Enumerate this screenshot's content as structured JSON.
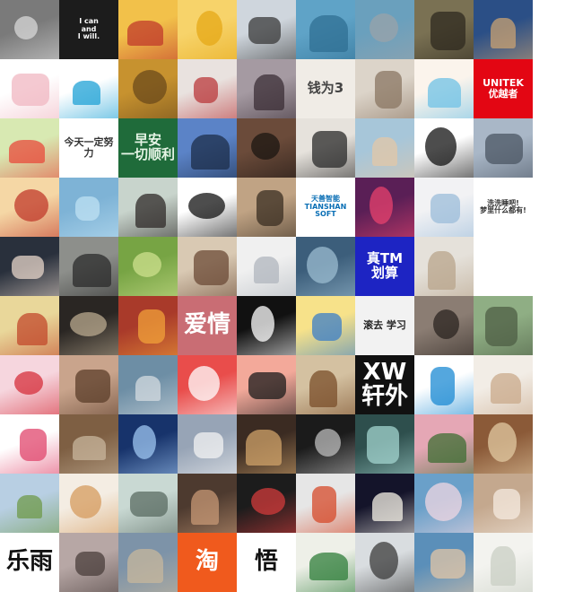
{
  "grid": {
    "columns": 9,
    "rows": 10,
    "tiles": [
      {
        "r": 0,
        "c": 0,
        "kind": "photo",
        "bg": "#7a7a7a",
        "fg": "#d8d8d8",
        "name": "child-street-photo"
      },
      {
        "r": 0,
        "c": 1,
        "kind": "text",
        "bg": "#1c1c1c",
        "fg": "#ffffff",
        "text": "I can\nand\nI will.",
        "name": "i-can-and-i-will-text"
      },
      {
        "r": 0,
        "c": 2,
        "kind": "photo",
        "bg": "#f2c14a",
        "fg": "#c0392b",
        "name": "one-piece-luffy-avatar"
      },
      {
        "r": 0,
        "c": 3,
        "kind": "photo",
        "bg": "#f7d36a",
        "fg": "#e6a817",
        "name": "emoji-face-avatar"
      },
      {
        "r": 0,
        "c": 4,
        "kind": "photo",
        "bg": "#cfd6dd",
        "fg": "#3a3a3a",
        "name": "headphones-boy-avatar"
      },
      {
        "r": 0,
        "c": 5,
        "kind": "photo",
        "bg": "#5fa3c7",
        "fg": "#2f6f93",
        "name": "boat-sea-photo"
      },
      {
        "r": 0,
        "c": 6,
        "kind": "photo",
        "bg": "#6aa0bd",
        "fg": "#9aa3aa",
        "name": "shark-photo"
      },
      {
        "r": 0,
        "c": 7,
        "kind": "photo",
        "bg": "#7a7153",
        "fg": "#2f2a1f",
        "name": "soldier-boy-photo"
      },
      {
        "r": 0,
        "c": 8,
        "kind": "photo",
        "bg": "#2b4f86",
        "fg": "#c9a172",
        "name": "coastal-town-photo"
      },
      {
        "r": 0,
        "c": 9,
        "kind": "photo",
        "bg": "#f3f3f3",
        "fg": "#c0392b",
        "name": "anime-red-hair-girl"
      },
      {
        "r": 1,
        "c": 0,
        "kind": "photo",
        "bg": "#ffffff",
        "fg": "#f0b7c2",
        "name": "cartoon-pig-avatar"
      },
      {
        "r": 1,
        "c": 1,
        "kind": "photo",
        "bg": "#ffffff",
        "fg": "#1fa2d6",
        "name": "music-note-logo"
      },
      {
        "r": 1,
        "c": 2,
        "kind": "photo",
        "bg": "#c7922f",
        "fg": "#6b4a1b",
        "name": "forest-trees-photo"
      },
      {
        "r": 1,
        "c": 3,
        "kind": "photo",
        "bg": "#e9e2df",
        "fg": "#b9383b",
        "name": "anime-girl-red-hat"
      },
      {
        "r": 1,
        "c": 4,
        "kind": "photo",
        "bg": "#a59aa2",
        "fg": "#3b2e36",
        "name": "dark-hair-girl-photo"
      },
      {
        "r": 1,
        "c": 5,
        "kind": "text",
        "bg": "#f0ece6",
        "fg": "#444444",
        "text": "钱为3",
        "name": "box-sketch-text"
      },
      {
        "r": 1,
        "c": 6,
        "kind": "photo",
        "bg": "#dcd4c9",
        "fg": "#8a7562",
        "name": "blonde-woman-photo"
      },
      {
        "r": 1,
        "c": 7,
        "kind": "photo",
        "bg": "#fbf4ec",
        "fg": "#6fc1e6",
        "name": "cinnamoroll-avatar"
      },
      {
        "r": 1,
        "c": 8,
        "kind": "text",
        "bg": "#e30613",
        "fg": "#ffffff",
        "text": "UNITEK\n优越者",
        "name": "unitek-logo"
      },
      {
        "r": 1,
        "c": 9,
        "kind": "empty",
        "bg": "#ffffff",
        "name": "empty-cell"
      },
      {
        "r": 2,
        "c": 0,
        "kind": "photo",
        "bg": "#d8e9b2",
        "fg": "#e84a3b",
        "name": "flowers-vase-photo"
      },
      {
        "r": 2,
        "c": 1,
        "kind": "text",
        "bg": "#ffffff",
        "fg": "#333333",
        "text": "今天一定努力",
        "name": "cartoon-determination-text"
      },
      {
        "r": 2,
        "c": 2,
        "kind": "text",
        "bg": "#1f6b3a",
        "fg": "#e6f5e6",
        "text": "早安\n一切顺利",
        "name": "good-morning-leaf-text"
      },
      {
        "r": 2,
        "c": 3,
        "kind": "photo",
        "bg": "#5b83c7",
        "fg": "#1c2d4a",
        "name": "lone-figure-sea-photo"
      },
      {
        "r": 2,
        "c": 4,
        "kind": "photo",
        "bg": "#6b4b3a",
        "fg": "#1b1512",
        "name": "bearded-man-photo"
      },
      {
        "r": 2,
        "c": 5,
        "kind": "photo",
        "bg": "#e6e2dc",
        "fg": "#2a2a2a",
        "name": "man-portrait-photo"
      },
      {
        "r": 2,
        "c": 6,
        "kind": "photo",
        "bg": "#a7c6d9",
        "fg": "#e3c7a7",
        "name": "child-beach-photo"
      },
      {
        "r": 2,
        "c": 7,
        "kind": "photo",
        "bg": "#ffffff",
        "fg": "#111111",
        "name": "ink-panda-drawing"
      },
      {
        "r": 2,
        "c": 8,
        "kind": "photo",
        "bg": "#a9b7c7",
        "fg": "#4b5563",
        "name": "road-landscape-photo"
      },
      {
        "r": 2,
        "c": 9,
        "kind": "empty",
        "bg": "#ffffff",
        "name": "empty-cell"
      },
      {
        "r": 3,
        "c": 0,
        "kind": "photo",
        "bg": "#f5d7a5",
        "fg": "#c0392b",
        "name": "luffy-smile-avatar"
      },
      {
        "r": 3,
        "c": 1,
        "kind": "photo",
        "bg": "#7eb3d6",
        "fg": "#bfe1f3",
        "name": "blue-sky-painting"
      },
      {
        "r": 3,
        "c": 2,
        "kind": "photo",
        "bg": "#c8d4cc",
        "fg": "#2f2a28",
        "name": "girl-smiling-photo"
      },
      {
        "r": 3,
        "c": 3,
        "kind": "photo",
        "bg": "#ffffff",
        "fg": "#111111",
        "name": "white-bear-icon"
      },
      {
        "r": 3,
        "c": 4,
        "kind": "photo",
        "bg": "#c0a384",
        "fg": "#3a2e22",
        "name": "sketch-boy-drawing"
      },
      {
        "r": 3,
        "c": 5,
        "kind": "text",
        "bg": "#ffffff",
        "fg": "#0a6fb5",
        "text": "天善智能\nTIANSHAN SOFT",
        "name": "tianshan-soft-logo"
      },
      {
        "r": 3,
        "c": 6,
        "kind": "photo",
        "bg": "#5a1f56",
        "fg": "#e8426d",
        "name": "city-night-skyline"
      },
      {
        "r": 3,
        "c": 7,
        "kind": "photo",
        "bg": "#f2f2f4",
        "fg": "#9bbcda",
        "name": "anime-white-hair-girl"
      },
      {
        "r": 3,
        "c": 8,
        "kind": "text",
        "bg": "#ffffff",
        "fg": "#333333",
        "text": "洗洗睡吧!\n梦里什么都有!",
        "name": "panda-meme-text"
      },
      {
        "r": 3,
        "c": 9,
        "kind": "empty",
        "bg": "#ffffff",
        "name": "empty-cell"
      },
      {
        "r": 4,
        "c": 0,
        "kind": "photo",
        "bg": "#29303c",
        "fg": "#e7d6c9",
        "name": "man-in-suit-photo"
      },
      {
        "r": 4,
        "c": 1,
        "kind": "photo",
        "bg": "#8d8f8b",
        "fg": "#2b2b2b",
        "name": "sketch-hands-photo"
      },
      {
        "r": 4,
        "c": 2,
        "kind": "photo",
        "bg": "#77a444",
        "fg": "#cde08d",
        "name": "green-hills-photo"
      },
      {
        "r": 4,
        "c": 3,
        "kind": "photo",
        "bg": "#d9c9b3",
        "fg": "#6b4a35",
        "name": "child-face-photo"
      },
      {
        "r": 4,
        "c": 4,
        "kind": "photo",
        "bg": "#f0f0f0",
        "fg": "#b0b6bd",
        "name": "anime-silver-hair-boy"
      },
      {
        "r": 4,
        "c": 5,
        "kind": "photo",
        "bg": "#3c5e7b",
        "fg": "#9bbcd0",
        "name": "mountain-lake-figure"
      },
      {
        "r": 4,
        "c": 6,
        "kind": "text",
        "bg": "#1d24c3",
        "fg": "#ffffff",
        "text": "真TM\n划算",
        "name": "zhen-tm-huasuan-text"
      },
      {
        "r": 4,
        "c": 7,
        "kind": "photo",
        "bg": "#e5e1da",
        "fg": "#b8a48b",
        "name": "woman-standing-photo"
      },
      {
        "r": 4,
        "c": 8,
        "kind": "empty",
        "bg": "#ffffff",
        "name": "empty-cell"
      },
      {
        "r": 4,
        "c": 9,
        "kind": "empty",
        "bg": "#ffffff",
        "name": "empty-cell"
      },
      {
        "r": 5,
        "c": 0,
        "kind": "photo",
        "bg": "#e9d79a",
        "fg": "#c1482b",
        "name": "girl-flowers-photo"
      },
      {
        "r": 5,
        "c": 1,
        "kind": "photo",
        "bg": "#2a2623",
        "fg": "#b9a98f",
        "name": "godfather-photo"
      },
      {
        "r": 5,
        "c": 2,
        "kind": "photo",
        "bg": "#a93a2a",
        "fg": "#f2a13a",
        "name": "circles-art-photo"
      },
      {
        "r": 5,
        "c": 3,
        "kind": "text",
        "bg": "#c96d74",
        "fg": "#ffffff",
        "text": "爱情",
        "name": "love-movie-poster"
      },
      {
        "r": 5,
        "c": 4,
        "kind": "photo",
        "bg": "#111111",
        "fg": "#ffffff",
        "name": "spiral-eyes-face"
      },
      {
        "r": 5,
        "c": 5,
        "kind": "photo",
        "bg": "#f7e28a",
        "fg": "#3b7ec7",
        "name": "cartoon-bowl-boy"
      },
      {
        "r": 5,
        "c": 6,
        "kind": "text",
        "bg": "#f2f2f2",
        "fg": "#222222",
        "text": "滚去 学习",
        "name": "go-study-text"
      },
      {
        "r": 5,
        "c": 7,
        "kind": "photo",
        "bg": "#8b7d73",
        "fg": "#2b2420",
        "name": "man-portrait-side-photo"
      },
      {
        "r": 5,
        "c": 8,
        "kind": "photo",
        "bg": "#8fae84",
        "fg": "#4d5d44",
        "name": "garden-path-photo"
      },
      {
        "r": 5,
        "c": 9,
        "kind": "empty",
        "bg": "#ffffff",
        "name": "empty-cell"
      },
      {
        "r": 6,
        "c": 0,
        "kind": "photo",
        "bg": "#f6d6de",
        "fg": "#d62f3b",
        "name": "santa-hat-girl-photo"
      },
      {
        "r": 6,
        "c": 1,
        "kind": "photo",
        "bg": "#c9a48c",
        "fg": "#5b3d2a",
        "name": "twin-babies-photo"
      },
      {
        "r": 6,
        "c": 2,
        "kind": "photo",
        "bg": "#6d8ea5",
        "fg": "#d4dbe0",
        "name": "glass-cup-photo"
      },
      {
        "r": 6,
        "c": 3,
        "kind": "photo",
        "bg": "#e94d4b",
        "fg": "#ffffff",
        "name": "anime-sketch-red"
      },
      {
        "r": 6,
        "c": 4,
        "kind": "photo",
        "bg": "#f3a99a",
        "fg": "#1b1b1b",
        "name": "cartoon-man-tie"
      },
      {
        "r": 6,
        "c": 5,
        "kind": "photo",
        "bg": "#d4c1a1",
        "fg": "#7a4e2a",
        "name": "curly-child-photo"
      },
      {
        "r": 6,
        "c": 6,
        "kind": "text",
        "bg": "#111111",
        "fg": "#ffffff",
        "text": "XW\n轩外",
        "name": "xw-logo"
      },
      {
        "r": 6,
        "c": 7,
        "kind": "photo",
        "bg": "#ffffff",
        "fg": "#1b8ad3",
        "name": "doraemon-avatar"
      },
      {
        "r": 6,
        "c": 8,
        "kind": "photo",
        "bg": "#f2ede6",
        "fg": "#c9a98b",
        "name": "cons-shirt-girl"
      },
      {
        "r": 6,
        "c": 9,
        "kind": "empty",
        "bg": "#ffffff",
        "name": "empty-cell"
      },
      {
        "r": 7,
        "c": 0,
        "kind": "photo",
        "bg": "#ffffff",
        "fg": "#e0466c",
        "name": "cartoon-cow-avatar"
      },
      {
        "r": 7,
        "c": 1,
        "kind": "photo",
        "bg": "#7e5f43",
        "fg": "#c8b59c",
        "name": "old-building-photo"
      },
      {
        "r": 7,
        "c": 2,
        "kind": "photo",
        "bg": "#17336b",
        "fg": "#9ec5f0",
        "name": "starry-sky-photo"
      },
      {
        "r": 7,
        "c": 3,
        "kind": "photo",
        "bg": "#97a4b6",
        "fg": "#f3f3f3",
        "name": "pencil-paper-photo"
      },
      {
        "r": 7,
        "c": 4,
        "kind": "photo",
        "bg": "#3b2b22",
        "fg": "#d0a36a",
        "name": "figurine-shelf-photo"
      },
      {
        "r": 7,
        "c": 5,
        "kind": "photo",
        "bg": "#1b1b1b",
        "fg": "#bcbcbc",
        "name": "man-bw-portrait"
      },
      {
        "r": 7,
        "c": 6,
        "kind": "photo",
        "bg": "#2e4f4d",
        "fg": "#a3d4cf",
        "name": "man-cap-photo"
      },
      {
        "r": 7,
        "c": 7,
        "kind": "photo",
        "bg": "#e5a7b5",
        "fg": "#3d6d33",
        "name": "peach-blossom-photo"
      },
      {
        "r": 7,
        "c": 8,
        "kind": "photo",
        "bg": "#8b5a38",
        "fg": "#e2c9a2",
        "name": "library-shelves-photo"
      },
      {
        "r": 7,
        "c": 9,
        "kind": "empty",
        "bg": "#ffffff",
        "name": "empty-cell"
      },
      {
        "r": 8,
        "c": 0,
        "kind": "photo",
        "bg": "#b8cfe3",
        "fg": "#6f9a4a",
        "name": "city-park-photo"
      },
      {
        "r": 8,
        "c": 1,
        "kind": "photo",
        "bg": "#f4ede3",
        "fg": "#d59b5e",
        "name": "sleeping-cat-drawing"
      },
      {
        "r": 8,
        "c": 2,
        "kind": "photo",
        "bg": "#c9d9d3",
        "fg": "#5a6b62",
        "name": "boy-tinted-photo"
      },
      {
        "r": 8,
        "c": 3,
        "kind": "photo",
        "bg": "#4d3a2f",
        "fg": "#c79875",
        "name": "child-eating-photo"
      },
      {
        "r": 8,
        "c": 4,
        "kind": "photo",
        "bg": "#1c1c1c",
        "fg": "#d23b3b",
        "name": "dancer-poster"
      },
      {
        "r": 8,
        "c": 5,
        "kind": "photo",
        "bg": "#e6e6e6",
        "fg": "#d64a2a",
        "name": "traffic-cone-street"
      },
      {
        "r": 8,
        "c": 6,
        "kind": "photo",
        "bg": "#14142a",
        "fg": "#f4f0e6",
        "name": "white-flower-photo"
      },
      {
        "r": 8,
        "c": 7,
        "kind": "photo",
        "bg": "#6aa0c9",
        "fg": "#f0d7e1",
        "name": "girl-sea-photo"
      },
      {
        "r": 8,
        "c": 8,
        "kind": "photo",
        "bg": "#c4a88e",
        "fg": "#f5ebe0",
        "name": "two-girls-photo"
      },
      {
        "r": 8,
        "c": 9,
        "kind": "empty",
        "bg": "#ffffff",
        "name": "empty-cell"
      },
      {
        "r": 9,
        "c": 0,
        "kind": "text",
        "bg": "#ffffff",
        "fg": "#111111",
        "text": "乐雨",
        "name": "meme-face-avatar"
      },
      {
        "r": 9,
        "c": 1,
        "kind": "photo",
        "bg": "#b7a7a5",
        "fg": "#493d3b",
        "name": "girl-street-photo"
      },
      {
        "r": 9,
        "c": 2,
        "kind": "photo",
        "bg": "#7d93a8",
        "fg": "#c7b79c",
        "name": "cat-sky-photo"
      },
      {
        "r": 9,
        "c": 3,
        "kind": "text",
        "bg": "#f05a1d",
        "fg": "#ffffff",
        "text": "淘",
        "name": "taobao-logo"
      },
      {
        "r": 9,
        "c": 4,
        "kind": "text",
        "bg": "#ffffff",
        "fg": "#111111",
        "text": "悟",
        "name": "calligraphy-wu"
      },
      {
        "r": 9,
        "c": 5,
        "kind": "photo",
        "bg": "#eef0e8",
        "fg": "#2f7d3a",
        "name": "certificate-logo"
      },
      {
        "r": 9,
        "c": 6,
        "kind": "photo",
        "bg": "#d9dde0",
        "fg": "#3b3b3b",
        "name": "woman-standing-indoor"
      },
      {
        "r": 9,
        "c": 7,
        "kind": "photo",
        "bg": "#5b8fb9",
        "fg": "#e2c5a7",
        "name": "girl-blue-sky-photo"
      },
      {
        "r": 9,
        "c": 8,
        "kind": "photo",
        "bg": "#f3f3ef",
        "fg": "#c9cfc4",
        "name": "light-sketch-photo"
      },
      {
        "r": 9,
        "c": 9,
        "kind": "empty",
        "bg": "#ffffff",
        "name": "empty-cell"
      }
    ]
  }
}
